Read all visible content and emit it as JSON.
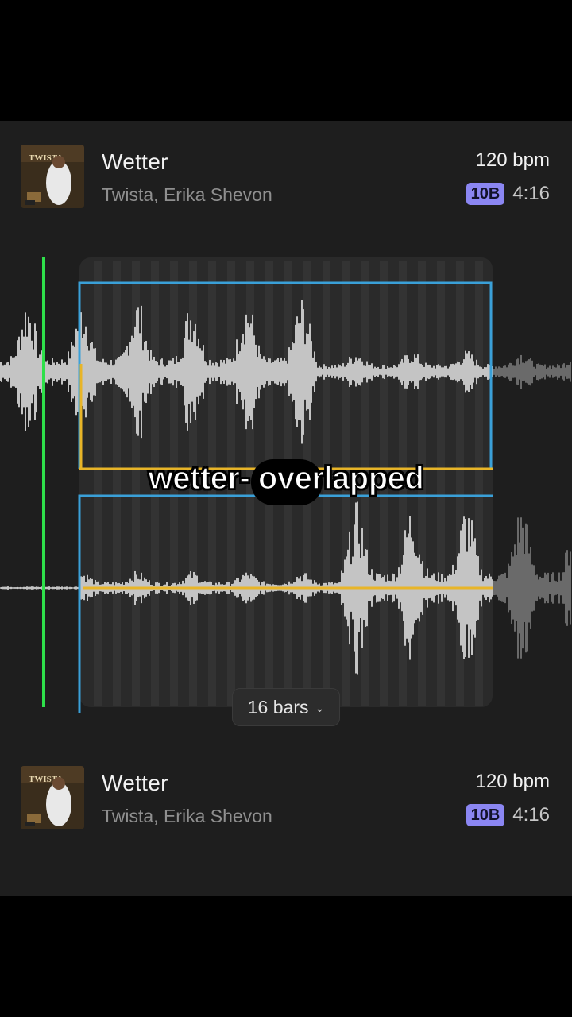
{
  "tracks": [
    {
      "title": "Wetter",
      "artist": "Twista, Erika Shevon",
      "bpm": "120 bpm",
      "key": "10B",
      "duration": "4:16"
    },
    {
      "title": "Wetter",
      "artist": "Twista, Erika Shevon",
      "bpm": "120 bpm",
      "key": "10B",
      "duration": "4:16"
    }
  ],
  "loop": {
    "bars_label": "16 bars"
  },
  "caption": "wetter- overlapped",
  "colors": {
    "playhead": "#2ee04a",
    "loop_border": "#3aa0d8",
    "transition_line": "#e8b528",
    "key_badge": "#8b86f2"
  }
}
